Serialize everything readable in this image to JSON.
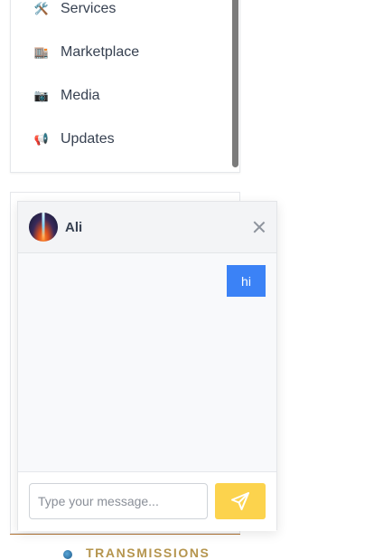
{
  "menu": {
    "items": [
      {
        "label": "Services",
        "emoji": "🛠️",
        "icon": "tools-icon"
      },
      {
        "label": "Marketplace",
        "emoji": "🏬",
        "icon": "store-icon"
      },
      {
        "label": "Media",
        "emoji": "📷",
        "icon": "camera-icon"
      },
      {
        "label": "Updates",
        "emoji": "📢",
        "icon": "megaphone-icon"
      }
    ]
  },
  "section": {
    "label": "TRANSMISSIONS"
  },
  "chat": {
    "name": "Ali",
    "messages": [
      {
        "from": "me",
        "text": "hi"
      }
    ],
    "input": {
      "value": "",
      "placeholder": "Type your message..."
    },
    "send_icon": "send-icon",
    "close_icon": "close-icon"
  },
  "colors": {
    "bubble": "#3b82f6",
    "send_button": "#fcd34d",
    "section_label": "#b5954e",
    "accent_line": "#b57a3b"
  }
}
